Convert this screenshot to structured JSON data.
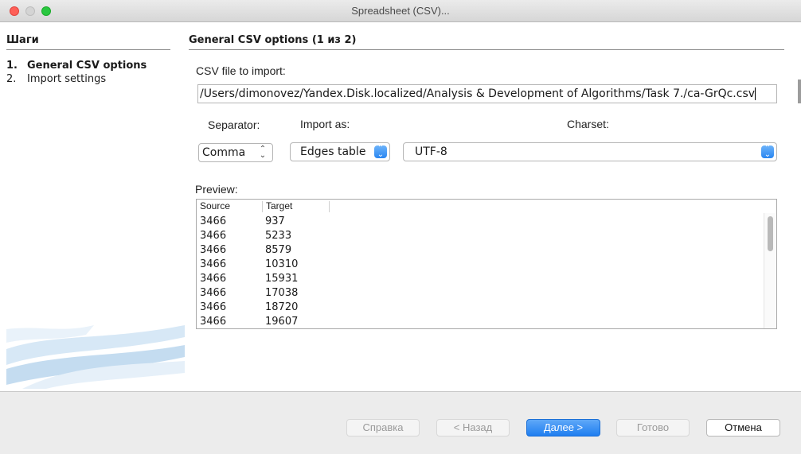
{
  "window": {
    "title": "Spreadsheet (CSV)..."
  },
  "steps": {
    "heading": "Шаги",
    "items": [
      {
        "num": "1.",
        "label": "General CSV options",
        "active": true
      },
      {
        "num": "2.",
        "label": "Import settings",
        "active": false
      }
    ]
  },
  "main": {
    "heading": "General CSV options (1 из 2)",
    "file_label": "CSV file to import:",
    "file_path": "/Users/dimonovez/Yandex.Disk.localized/Analysis & Development of Algorithms/Task 7./ca-GrQc.csv",
    "separator_label": "Separator:",
    "separator_value": "Comma",
    "import_as_label": "Import as:",
    "import_as_value": "Edges table",
    "charset_label": "Charset:",
    "charset_value": "UTF-8",
    "preview_label": "Preview:",
    "preview": {
      "columns": [
        "Source",
        "Target"
      ],
      "rows": [
        [
          "3466",
          "937"
        ],
        [
          "3466",
          "5233"
        ],
        [
          "3466",
          "8579"
        ],
        [
          "3466",
          "10310"
        ],
        [
          "3466",
          "15931"
        ],
        [
          "3466",
          "17038"
        ],
        [
          "3466",
          "18720"
        ],
        [
          "3466",
          "19607"
        ]
      ]
    }
  },
  "footer": {
    "help": "Справка",
    "back": "< Назад",
    "next": "Далее >",
    "finish": "Готово",
    "cancel": "Отмена"
  }
}
